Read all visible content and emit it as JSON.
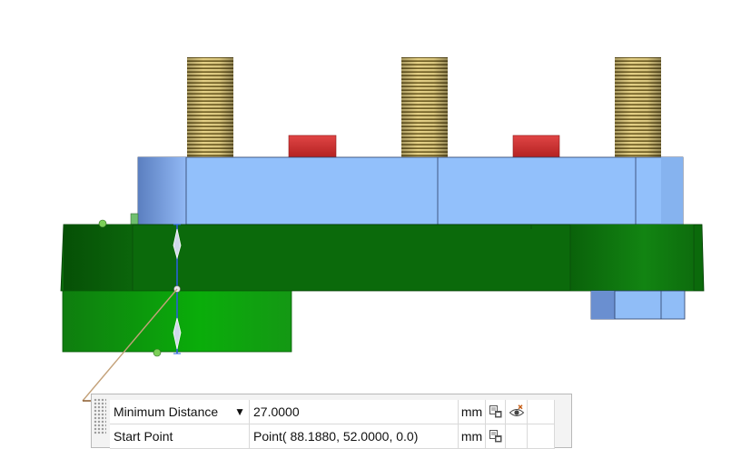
{
  "measurement_panel": {
    "rows": [
      {
        "label": "Minimum Distance",
        "dropdown_glyph": "▼",
        "value": "27.0000",
        "unit": "mm",
        "icons": [
          "copy-to-clipboard-icon",
          "visibility-toggle-icon"
        ]
      },
      {
        "label": "Start Point",
        "value": "Point( 88.1880, 52.0000, 0.0)",
        "unit": "mm",
        "icons": [
          "copy-to-clipboard-icon"
        ]
      }
    ]
  },
  "colors": {
    "plate_blue": "#91c3fb",
    "plate_blue_dark": "#5f84c4",
    "base_green": "#0e6b0e",
    "base_green_dark": "#064f06",
    "lower_green": "#10a810",
    "thread_gold": "#c9b46a",
    "pin_red": "#d63737",
    "measure_line": "#2a5fd6",
    "leader_line": "#8a5a2c"
  }
}
